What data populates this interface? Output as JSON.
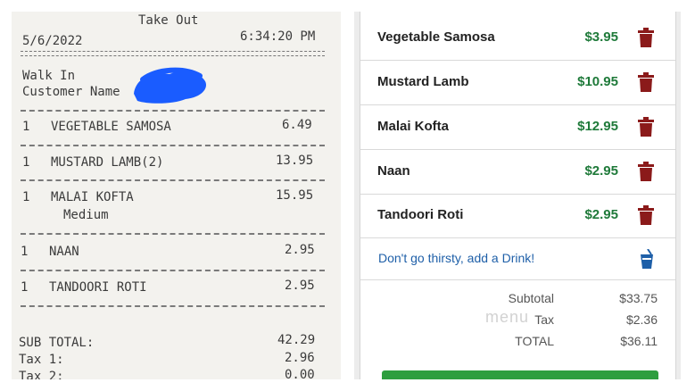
{
  "receipt": {
    "header": "Take Out",
    "date": "5/6/2022",
    "time": "6:34:20 PM",
    "walk_in": "Walk In",
    "customer_name_label": "Customer Name",
    "items": [
      {
        "qty": "1",
        "name": "VEGETABLE SAMOSA",
        "price": "6.49"
      },
      {
        "qty": "1",
        "name": "MUSTARD LAMB(2)",
        "price": "13.95"
      },
      {
        "qty": "1",
        "name": "MALAI KOFTA",
        "sub": "Medium",
        "price": "15.95"
      },
      {
        "qty": "1",
        "name": "NAAN",
        "price": "2.95"
      },
      {
        "qty": "1",
        "name": "TANDOORI ROTI",
        "price": "2.95"
      }
    ],
    "sub_total_label": "SUB TOTAL:",
    "sub_total": "42.29",
    "tax1_label": "Tax 1:",
    "tax1": "2.96",
    "tax2_label": "Tax 2:",
    "tax2": "0.00"
  },
  "cart": {
    "items": [
      {
        "name": "Vegetable Samosa",
        "price": "$3.95"
      },
      {
        "name": "Mustard Lamb",
        "price": "$10.95"
      },
      {
        "name": "Malai Kofta",
        "price": "$12.95"
      },
      {
        "name": "Naan",
        "price": "$2.95"
      },
      {
        "name": "Tandoori Roti",
        "price": "$2.95"
      }
    ],
    "drink_prompt": "Don't go thirsty, add a Drink!",
    "subtotal_label": "Subtotal",
    "subtotal": "$33.75",
    "tax_label": "Tax",
    "tax": "$2.36",
    "total_label": "TOTAL",
    "total": "$36.11",
    "watermark": "menu"
  },
  "colors": {
    "price_green": "#1f7a3a",
    "trash_red": "#8b1a1a",
    "link_blue": "#1e5fa8",
    "redaction_blue": "#1a5cff"
  },
  "icons": [
    "trash-icon",
    "drink-cup-icon"
  ]
}
